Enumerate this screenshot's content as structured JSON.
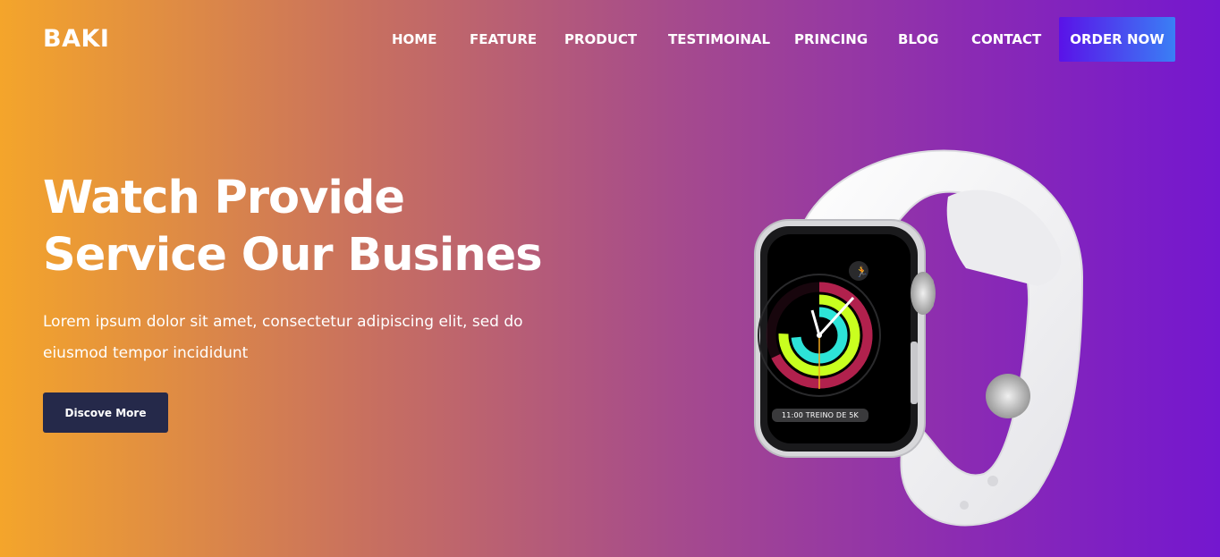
{
  "brand": {
    "logo": "BAKI"
  },
  "nav": {
    "items": [
      "HOME",
      "FEATURE",
      "PRODUCT",
      "TESTIMOINAL",
      "PRINCING",
      "BLOG",
      "CONTACT"
    ],
    "order_label": "ORDER NOW"
  },
  "hero": {
    "title_line1": "Watch Provide",
    "title_line2": "Service Our Busines",
    "text": "Lorem ipsum dolor sit amet, consectetur adipiscing elit, sed do eiusmod tempor incididunt",
    "button_label": "Discove More"
  },
  "watch": {
    "screen_caption": "11:00 TREINO DE 5K"
  },
  "colors": {
    "gradient_start": "#f4a52b",
    "gradient_end": "#7417cf",
    "order_button_start": "#5a12e8",
    "order_button_end": "#3a7ff5",
    "discover_button": "#25294a"
  }
}
